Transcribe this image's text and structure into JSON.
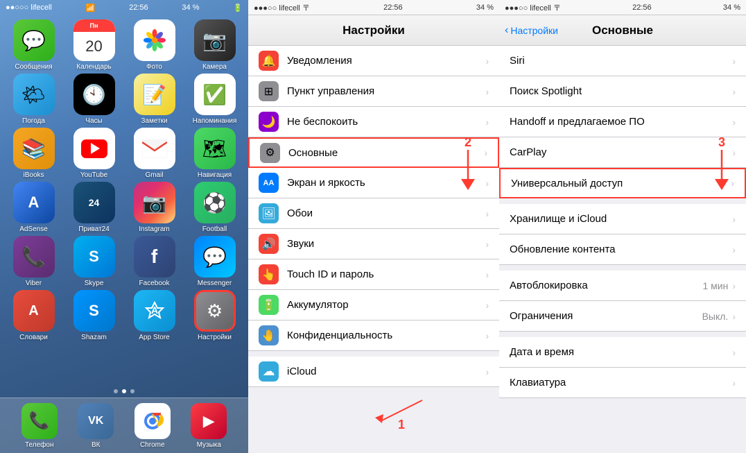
{
  "phones": {
    "phone1": {
      "statusBar": {
        "carrier": "●●○○○ lifecell",
        "wifi": "▾",
        "time": "22:56",
        "battery": "34 %"
      },
      "apps": [
        {
          "id": "messages",
          "label": "Сообщения",
          "icon": "💬",
          "iconClass": "icon-messages"
        },
        {
          "id": "calendar",
          "label": "Календарь",
          "icon": "cal",
          "iconClass": "icon-calendar"
        },
        {
          "id": "photos",
          "label": "Фото",
          "icon": "🌸",
          "iconClass": "icon-photos"
        },
        {
          "id": "camera",
          "label": "Камера",
          "icon": "📷",
          "iconClass": "icon-camera"
        },
        {
          "id": "weather",
          "label": "Погода",
          "icon": "🌤",
          "iconClass": "icon-weather"
        },
        {
          "id": "clock",
          "label": "Часы",
          "icon": "🕐",
          "iconClass": "icon-clock"
        },
        {
          "id": "notes",
          "label": "Заметки",
          "icon": "📝",
          "iconClass": "icon-notes"
        },
        {
          "id": "reminders",
          "label": "Напоминания",
          "icon": "✅",
          "iconClass": "icon-reminders"
        },
        {
          "id": "ibooks",
          "label": "iBooks",
          "icon": "📚",
          "iconClass": "icon-ibooks"
        },
        {
          "id": "youtube",
          "label": "YouTube",
          "icon": "▶",
          "iconClass": "icon-youtube"
        },
        {
          "id": "gmail",
          "label": "Gmail",
          "icon": "M",
          "iconClass": "icon-gmail"
        },
        {
          "id": "navigation",
          "label": "Навигация",
          "icon": "🗺",
          "iconClass": "icon-navigation"
        },
        {
          "id": "adsense",
          "label": "AdSense",
          "icon": "A",
          "iconClass": "icon-adsense"
        },
        {
          "id": "privat24",
          "label": "Приват24",
          "icon": "24",
          "iconClass": "icon-privat24"
        },
        {
          "id": "instagram",
          "label": "Instagram",
          "icon": "📷",
          "iconClass": "icon-instagram"
        },
        {
          "id": "football",
          "label": "Football",
          "icon": "⚽",
          "iconClass": "icon-football"
        },
        {
          "id": "viber",
          "label": "Viber",
          "icon": "📞",
          "iconClass": "icon-viber"
        },
        {
          "id": "skype",
          "label": "Skype",
          "icon": "S",
          "iconClass": "icon-skype"
        },
        {
          "id": "facebook",
          "label": "Facebook",
          "icon": "f",
          "iconClass": "icon-facebook"
        },
        {
          "id": "messenger",
          "label": "Messenger",
          "icon": "💬",
          "iconClass": "icon-messenger"
        },
        {
          "id": "slovari",
          "label": "Словари",
          "icon": "A",
          "iconClass": "icon-slovari"
        },
        {
          "id": "shazam",
          "label": "Shazam",
          "icon": "S",
          "iconClass": "icon-shazam"
        },
        {
          "id": "appstore",
          "label": "App Store",
          "icon": "A",
          "iconClass": "icon-appstore"
        },
        {
          "id": "settings",
          "label": "Настройки",
          "icon": "⚙",
          "iconClass": "icon-settings"
        }
      ],
      "dock": [
        {
          "id": "phone",
          "label": "Телефон",
          "icon": "📞",
          "iconClass": "icon-messages"
        },
        {
          "id": "vk",
          "label": "ВК",
          "icon": "VK",
          "iconClass": "icon-skype"
        },
        {
          "id": "chrome",
          "label": "Chrome",
          "icon": "●",
          "iconClass": "icon-adsense"
        },
        {
          "id": "music",
          "label": "Музыка",
          "icon": "▶",
          "iconClass": "icon-youtube"
        }
      ]
    },
    "phone2": {
      "statusBar": {
        "carrier": "●●●○○ lifecell",
        "wifi": "▾",
        "time": "22:56",
        "battery": "34 %"
      },
      "title": "Настройки",
      "items": [
        {
          "id": "notifications",
          "label": "Уведомления",
          "iconClass": "si-notifications",
          "icon": "🔔"
        },
        {
          "id": "control",
          "label": "Пункт управления",
          "iconClass": "si-control",
          "icon": "⊞"
        },
        {
          "id": "dnd",
          "label": "Не беспокоить",
          "iconClass": "si-dnd",
          "icon": "🌙"
        },
        {
          "id": "general",
          "label": "Основные",
          "iconClass": "si-general",
          "icon": "⚙",
          "highlighted": true
        },
        {
          "id": "display",
          "label": "Экран и яркость",
          "iconClass": "si-display",
          "icon": "AA"
        },
        {
          "id": "wallpaper",
          "label": "Обои",
          "iconClass": "si-wallpaper",
          "icon": "🖼"
        },
        {
          "id": "sounds",
          "label": "Звуки",
          "iconClass": "si-sounds",
          "icon": "🔊"
        },
        {
          "id": "touchid",
          "label": "Touch ID и пароль",
          "iconClass": "si-touchid",
          "icon": "👆"
        },
        {
          "id": "battery",
          "label": "Аккумулятор",
          "iconClass": "si-battery",
          "icon": "🔋"
        },
        {
          "id": "privacy",
          "label": "Конфиденциальность",
          "iconClass": "si-privacy",
          "icon": "🤚"
        },
        {
          "id": "icloud",
          "label": "iCloud",
          "iconClass": "si-icloud",
          "icon": "☁"
        }
      ],
      "annotation": "2"
    },
    "phone3": {
      "statusBar": {
        "carrier": "●●●○○ lifecell",
        "wifi": "▾",
        "time": "22:56",
        "battery": "34 %"
      },
      "backLabel": "Настройки",
      "title": "Основные",
      "items": [
        {
          "id": "siri",
          "label": "Siri",
          "value": ""
        },
        {
          "id": "spotlight",
          "label": "Поиск Spotlight",
          "value": ""
        },
        {
          "id": "handoff",
          "label": "Handoff и предлагаемое ПО",
          "value": ""
        },
        {
          "id": "carplay",
          "label": "CarPlay",
          "value": ""
        },
        {
          "id": "universal",
          "label": "Универсальный доступ",
          "value": "",
          "highlighted": true
        },
        {
          "id": "storage",
          "label": "Хранилище и iCloud",
          "value": ""
        },
        {
          "id": "update",
          "label": "Обновление контента",
          "value": ""
        },
        {
          "id": "autolock",
          "label": "Автоблокировка",
          "value": "1 мин"
        },
        {
          "id": "restrictions",
          "label": "Ограничения",
          "value": "Выкл."
        },
        {
          "id": "datetime",
          "label": "Дата и время",
          "value": ""
        },
        {
          "id": "keyboard",
          "label": "Клавиатура",
          "value": ""
        }
      ],
      "annotation": "3"
    }
  }
}
